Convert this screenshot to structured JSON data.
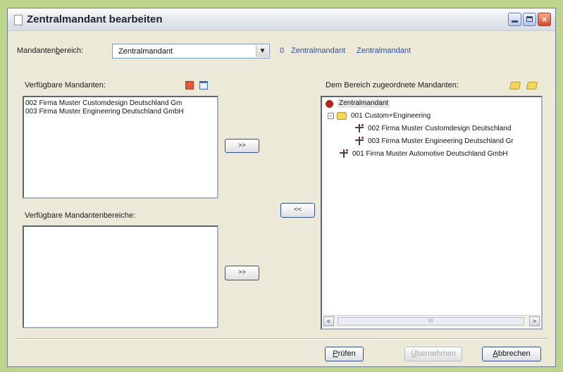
{
  "window": {
    "title": "Zentralmandant bearbeiten",
    "buttons": {
      "minimize": "_",
      "maximize": "□",
      "close": "×"
    }
  },
  "bereich": {
    "label_pre": "Mandanten",
    "label_acc": "b",
    "label_post": "ereich:",
    "selected": "Zentralmandant",
    "info_code": "0",
    "info_name1": "Zentralmandant",
    "info_name2": "Zentralmandant"
  },
  "available": {
    "label": "Verfügbare Mandanten:",
    "items": [
      "002  Firma  Muster Customdesign Deutschland Gm",
      "003  Firma  Muster Engineering Deutschland GmbH"
    ],
    "add_button": ">>"
  },
  "areas": {
    "label": "Verfügbare Mandantenbereiche:",
    "items": [],
    "add_button": ">>"
  },
  "remove_button": "<<",
  "assigned": {
    "label": "Dem Bereich zugeordnete Mandanten:",
    "tree": {
      "root": "Zentralmandant",
      "group_expander": "⊖",
      "group": "001  Custom+Engineering",
      "group_children": [
        "002  Firma Muster Customdesign Deutschland",
        "003  Firma Muster Engineering Deutschland Gr"
      ],
      "direct": "001  Firma Muster Automotive Deutschland GmbH"
    },
    "scroll_left": "<",
    "scroll_right": ">",
    "scroll_thumb": "III"
  },
  "footer": {
    "check_acc": "P",
    "check_rest": "rüfen",
    "apply_acc": "Ü",
    "apply_rest": "bernehmen",
    "cancel_acc": "A",
    "cancel_rest": "bbrechen"
  }
}
